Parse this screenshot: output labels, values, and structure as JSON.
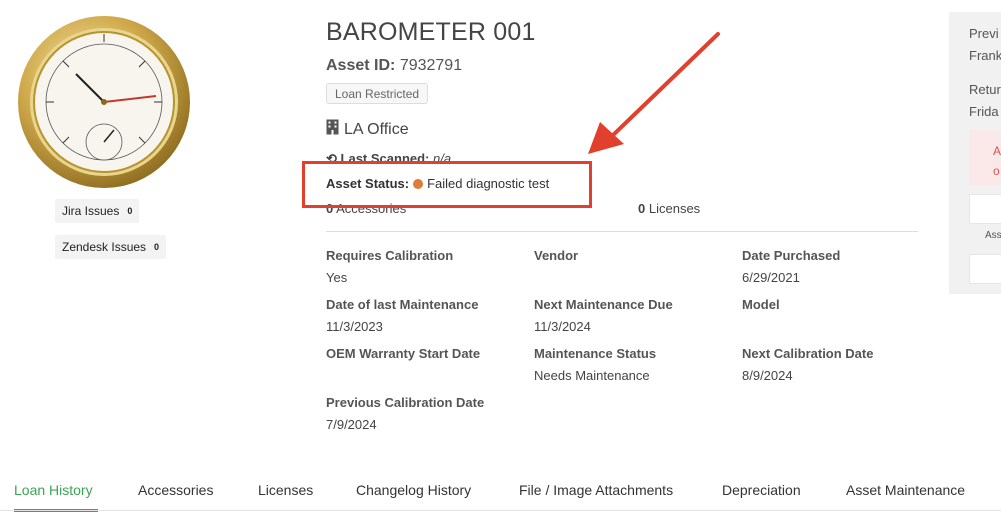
{
  "asset": {
    "title": "BAROMETER 001",
    "id_label": "Asset ID:",
    "id_value": "7932791",
    "loan_badge": "Loan Restricted",
    "location": "LA Office",
    "last_scanned_label": "Last Scanned:",
    "last_scanned_value": "n/a",
    "status_label": "Asset Status:",
    "status_value": "Failed diagnostic test",
    "status_color": "#e07b39",
    "accessories_count": "0",
    "accessories_label": "Accessories",
    "licenses_count": "0",
    "licenses_label": "Licenses"
  },
  "left_chips": [
    {
      "label": "Jira Issues",
      "count": "0"
    },
    {
      "label": "Zendesk Issues",
      "count": "0"
    }
  ],
  "fields": [
    {
      "label": "Requires Calibration",
      "value": "Yes"
    },
    {
      "label": "Vendor",
      "value": ""
    },
    {
      "label": "Date Purchased",
      "value": "6/29/2021"
    },
    {
      "label": "Date of last Maintenance",
      "value": "11/3/2023"
    },
    {
      "label": "Next Maintenance Due",
      "value": "11/3/2024"
    },
    {
      "label": "Model",
      "value": ""
    },
    {
      "label": "OEM Warranty Start Date",
      "value": ""
    },
    {
      "label": "Maintenance Status",
      "value": "Needs Maintenance"
    },
    {
      "label": "Next Calibration Date",
      "value": "8/9/2024"
    },
    {
      "label": "Previous Calibration Date",
      "value": "7/9/2024"
    }
  ],
  "right_panel": {
    "line1": "Previ",
    "line2": "Frank",
    "line3": "Retur",
    "line4": "Frida",
    "alert1": "A",
    "alert2": "o",
    "caption": "Ass"
  },
  "tabs": [
    {
      "label": "Loan History",
      "active": true
    },
    {
      "label": "Accessories"
    },
    {
      "label": "Licenses"
    },
    {
      "label": "Changelog History"
    },
    {
      "label": "File / Image Attachments"
    },
    {
      "label": "Depreciation"
    },
    {
      "label": "Asset Maintenance"
    }
  ],
  "colors": {
    "accent_green": "#3aa655",
    "annotation_red": "#e1402c"
  },
  "icons": [
    "building-icon",
    "barcode-scan-icon",
    "status-dot-icon"
  ]
}
